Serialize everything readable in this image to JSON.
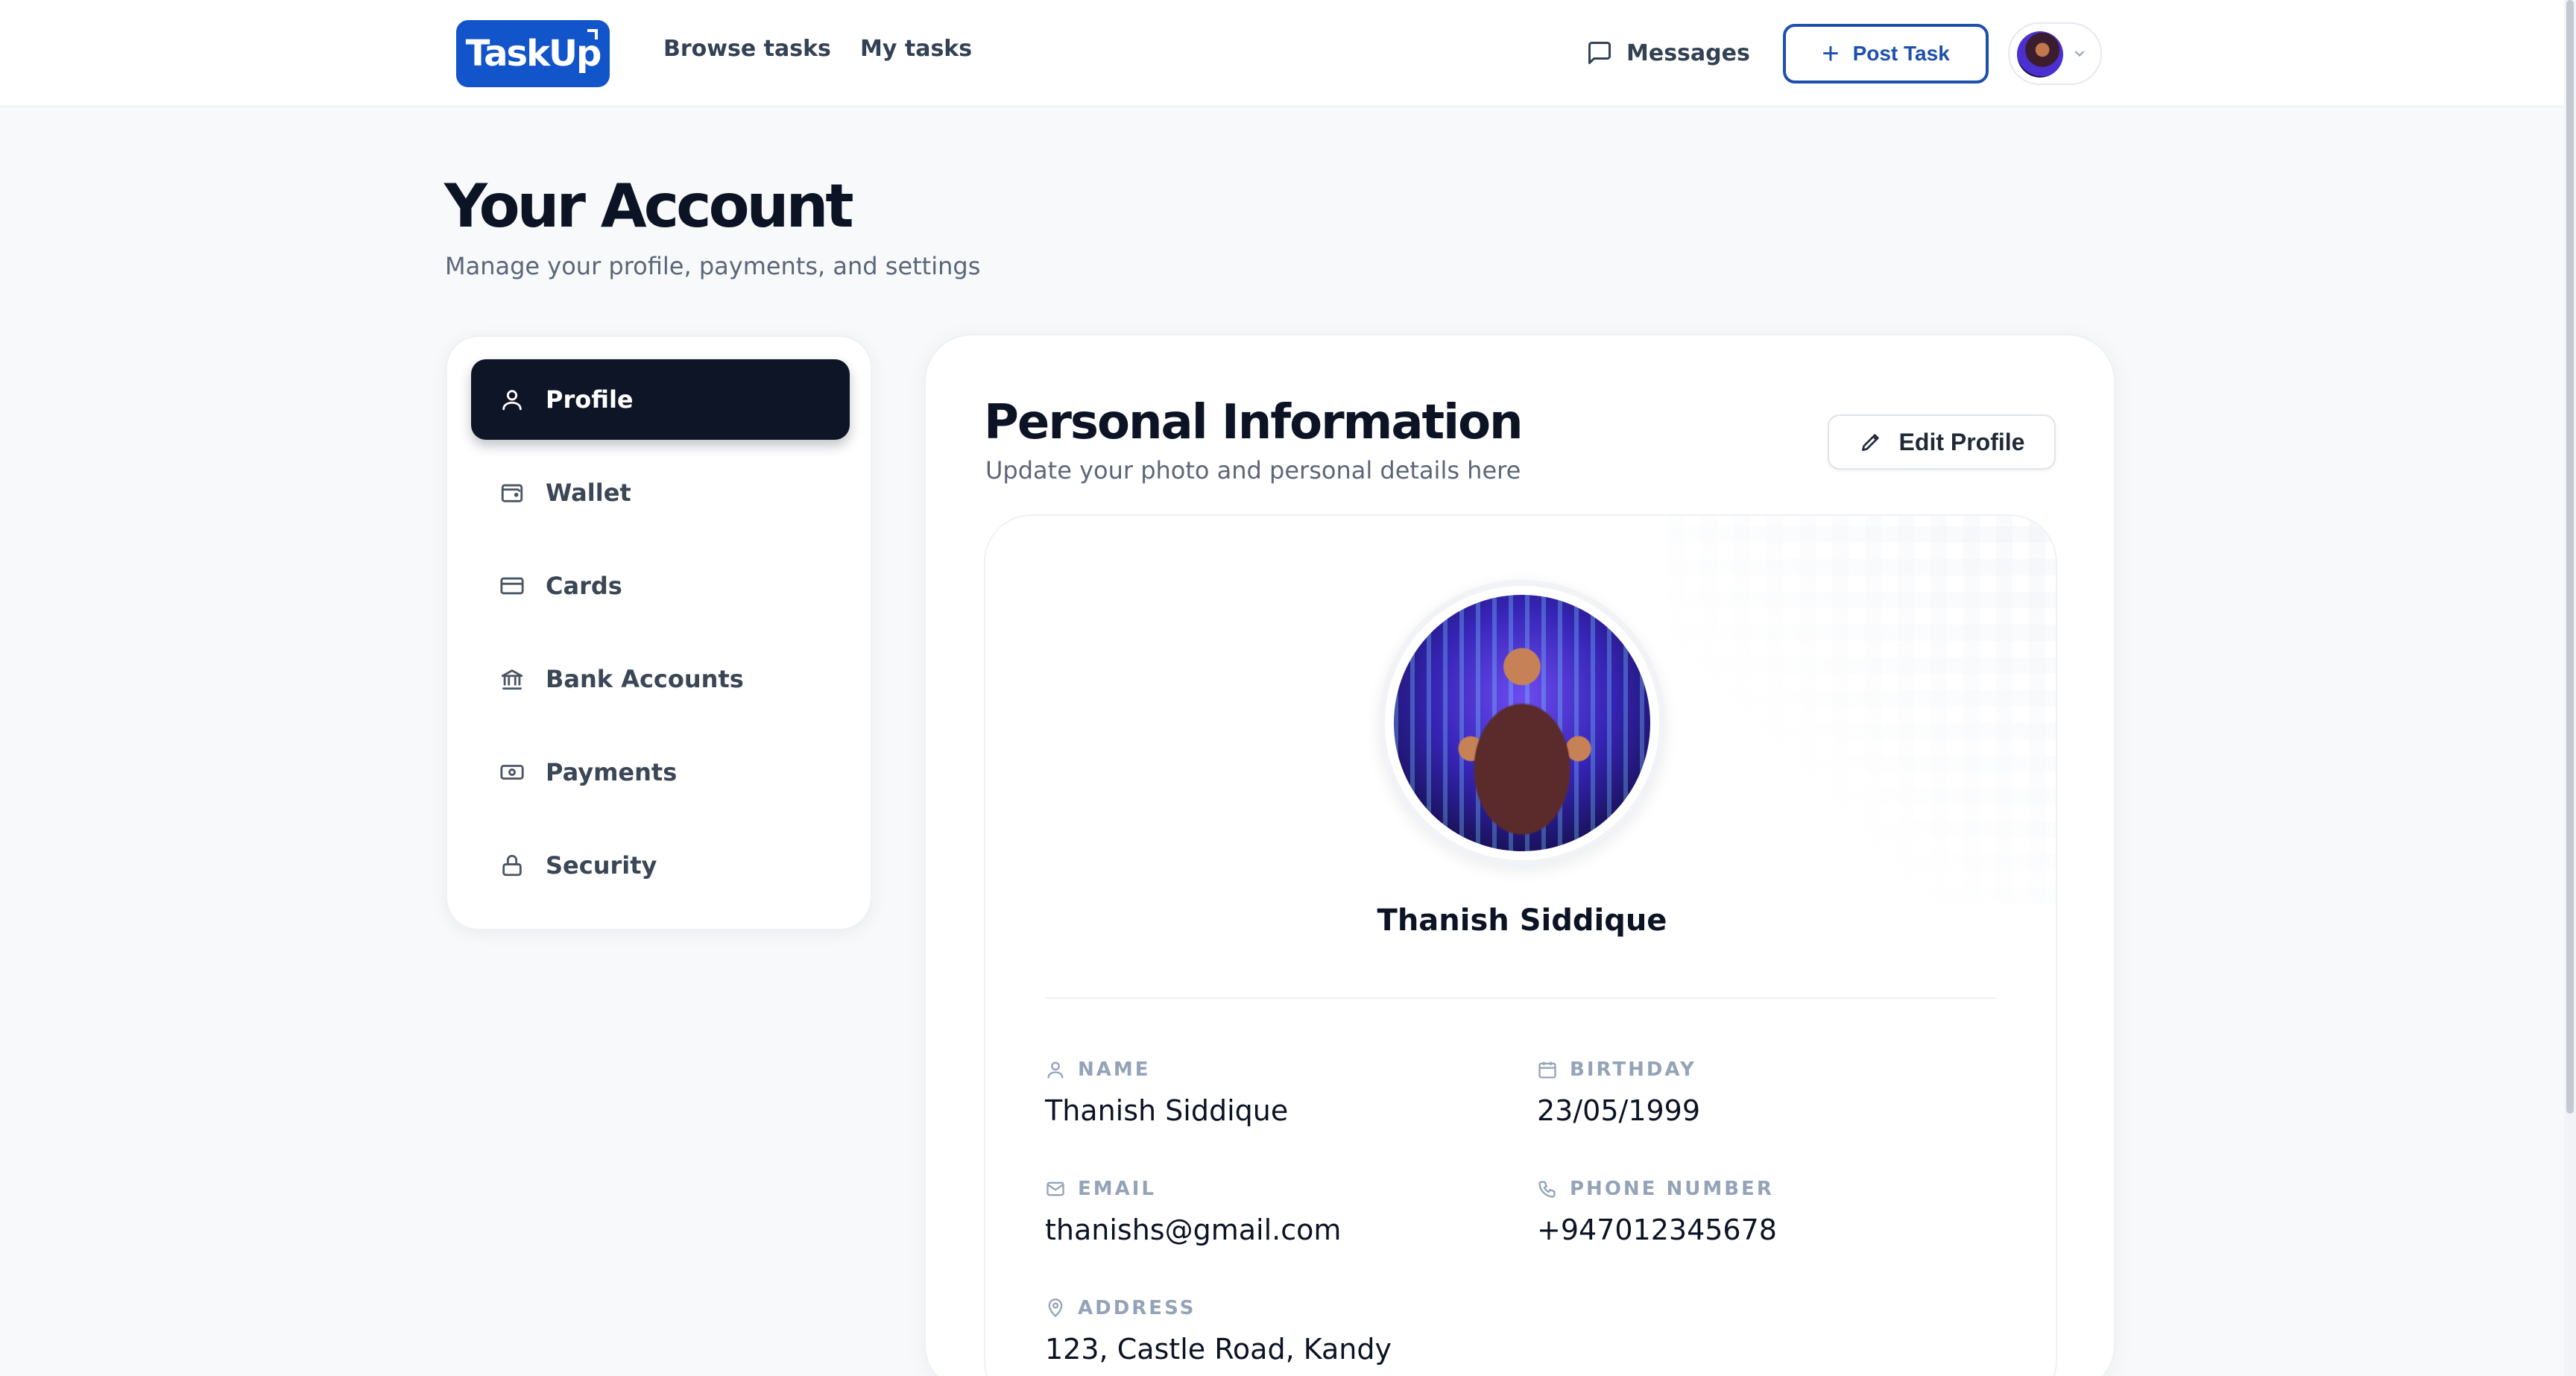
{
  "header": {
    "logo_text": "TaskUp",
    "nav": [
      {
        "label": "Browse tasks"
      },
      {
        "label": "My tasks"
      }
    ],
    "messages_label": "Messages",
    "post_task_label": "Post Task"
  },
  "page": {
    "title": "Your Account",
    "subtitle": "Manage your profile, payments, and settings"
  },
  "sidebar": {
    "items": [
      {
        "label": "Profile",
        "icon": "user-icon",
        "active": true
      },
      {
        "label": "Wallet",
        "icon": "wallet-icon",
        "active": false
      },
      {
        "label": "Cards",
        "icon": "credit-card-icon",
        "active": false
      },
      {
        "label": "Bank Accounts",
        "icon": "bank-icon",
        "active": false
      },
      {
        "label": "Payments",
        "icon": "banknote-icon",
        "active": false
      },
      {
        "label": "Security",
        "icon": "lock-icon",
        "active": false
      }
    ]
  },
  "personal_info": {
    "title": "Personal Information",
    "subtitle": "Update your photo and personal details here",
    "edit_label": "Edit Profile",
    "display_name": "Thanish Siddique",
    "fields": {
      "name": {
        "label": "NAME",
        "value": "Thanish Siddique",
        "icon": "user-icon"
      },
      "birthday": {
        "label": "BIRTHDAY",
        "value": "23/05/1999",
        "icon": "calendar-icon"
      },
      "email": {
        "label": "EMAIL",
        "value": "thanishs@gmail.com",
        "icon": "mail-icon"
      },
      "phone": {
        "label": "PHONE NUMBER",
        "value": "+947012345678",
        "icon": "phone-icon"
      },
      "address": {
        "label": "ADDRESS",
        "value": "123, Castle Road, Kandy",
        "icon": "map-pin-icon"
      }
    }
  },
  "colors": {
    "brand": "#1254c9",
    "active_nav": "#0d1526",
    "post_task_border": "#1e4fae",
    "muted_text": "#5b6678",
    "label_text": "#94a3b8"
  }
}
